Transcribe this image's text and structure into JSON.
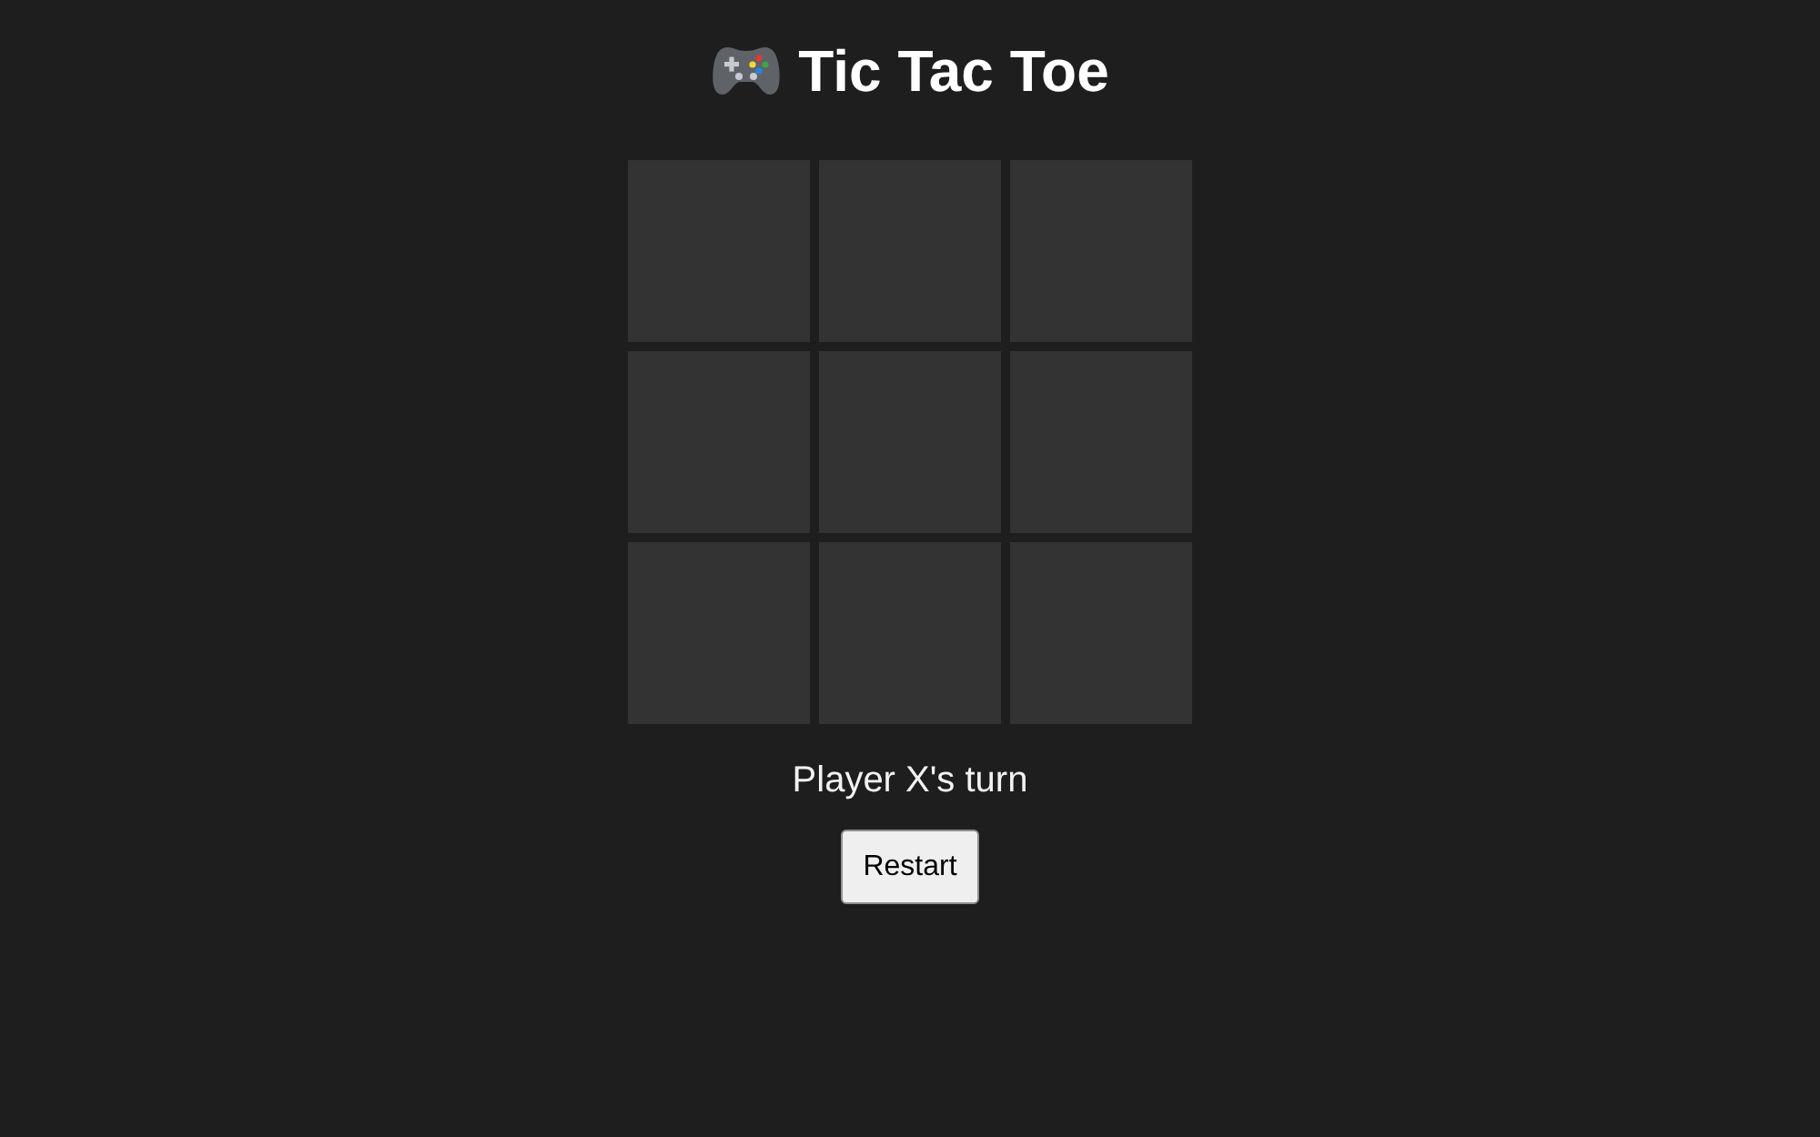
{
  "header": {
    "title": "Tic Tac Toe"
  },
  "board": {
    "cells": [
      {
        "kind": "empty"
      },
      {
        "kind": "empty"
      },
      {
        "kind": "empty"
      },
      {
        "kind": "empty"
      },
      {
        "kind": "empty"
      },
      {
        "kind": "empty"
      },
      {
        "kind": "empty"
      },
      {
        "kind": "empty"
      },
      {
        "kind": "empty"
      }
    ]
  },
  "status": "Player X's turn",
  "buttons": [
    "Restart"
  ]
}
